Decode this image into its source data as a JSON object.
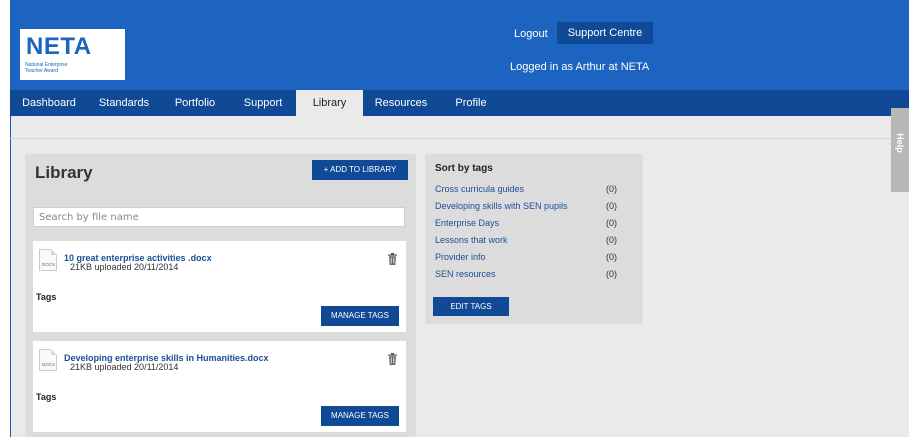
{
  "header": {
    "logo_title": "NETA",
    "logo_subtitle": "National Enterprise Teacher Award",
    "logout_label": "Logout",
    "support_centre_label": "Support Centre",
    "logged_in_text": "Logged in as Arthur at NETA"
  },
  "nav": {
    "items": [
      {
        "label": "Dashboard"
      },
      {
        "label": "Standards"
      },
      {
        "label": "Portfolio"
      },
      {
        "label": "Support"
      },
      {
        "label": "Library",
        "active": true
      },
      {
        "label": "Resources"
      },
      {
        "label": "Profile"
      }
    ]
  },
  "help_tab": {
    "label": "Help"
  },
  "library": {
    "title": "Library",
    "add_button_label": "+ ADD TO LIBRARY",
    "search_placeholder": "Search by file name",
    "files": [
      {
        "icon_label": "DOCX",
        "name": "10 great enterprise activities .docx",
        "meta": "21KB uploaded 20/11/2014",
        "tags_label": "Tags",
        "manage_tags_label": "MANAGE TAGS"
      },
      {
        "icon_label": "DOCX",
        "name": "Developing enterprise skills in Humanities.docx",
        "meta": "21KB uploaded 20/11/2014",
        "tags_label": "Tags",
        "manage_tags_label": "MANAGE TAGS"
      }
    ]
  },
  "sort_by_tags": {
    "title": "Sort by tags",
    "tags": [
      {
        "name": "Cross curricula guides",
        "count": "(0)"
      },
      {
        "name": "Developing skills with SEN pupils",
        "count": "(0)"
      },
      {
        "name": "Enterprise Days",
        "count": "(0)"
      },
      {
        "name": "Lessons that work",
        "count": "(0)"
      },
      {
        "name": "Provider info",
        "count": "(0)"
      },
      {
        "name": "SEN resources",
        "count": "(0)"
      }
    ],
    "edit_tags_label": "EDIT TAGS"
  },
  "colors": {
    "header_blue": "#1c64c0",
    "nav_dark_blue": "#104a97",
    "link_blue": "#1b4f95",
    "panel_grey": "#dcdcdc",
    "page_grey": "#eaeaea"
  }
}
